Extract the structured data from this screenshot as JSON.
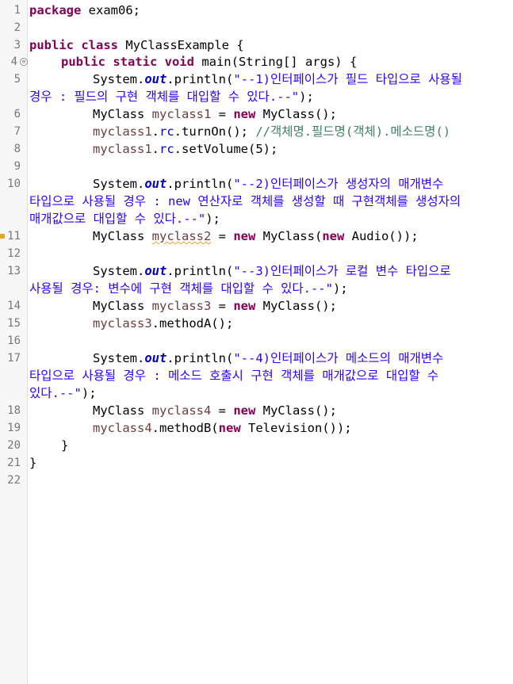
{
  "editor": {
    "line_numbers": [
      "1",
      "2",
      "3",
      "4",
      "5",
      "6",
      "7",
      "8",
      "9",
      "10",
      "11",
      "12",
      "13",
      "14",
      "15",
      "16",
      "17",
      "18",
      "19",
      "20",
      "21",
      "22"
    ],
    "icons": {
      "fold_marker": "collapse-icon",
      "warning_marker": "warning-icon"
    },
    "colors": {
      "keyword": "#7f0055",
      "string": "#2a00ff",
      "comment": "#3f7f5f",
      "local_variable": "#6a3e3e",
      "field": "#0000c0"
    },
    "tokens": {
      "package_kw": "package",
      "package_name": " exam06;",
      "public_kw": "public",
      "class_kw": " class",
      "class_decl": " MyClassExample {",
      "method_mods": "public static void",
      "main_sig": " main(String[] args) {",
      "sysout_prefix": "System.",
      "out": "out",
      "println_open": ".println(",
      "str1a": "\"--1)인터페이스가 필드 타입으로 사용될",
      "str1b": "경우 : 필드의 구현 객체를 대입할 수 있다.--\"",
      "close_paren_semi": ");",
      "myclass_type": "MyClass ",
      "myclass1": "myclass1",
      "assign_eq": " = ",
      "new_kw": "new",
      "myclass_ctor": " MyClass();",
      "dot": ".",
      "rc": "rc",
      "turnon": ".turnOn(); ",
      "comment7": "//객체명.필드명(객체).메소드명()",
      "setvolume": ".setVolume(5);",
      "str2a": "\"--2)인터페이스가 생성자의 매개변수",
      "str2b": "타입으로 사용될 경우 : new 연산자로 객체를 생성할 때 구현객체를 생성자의",
      "str2c": "매개값으로 대입할 수 있다.--\"",
      "myclass2": "myclass2",
      "myclass_open": " MyClass(",
      "audio_call": " Audio());",
      "str3a": "\"--3)인터페이스가 로컬 변수 타입으로",
      "str3b": "사용될 경우: 변수에 구현 객체를 대입할 수 있다.--\"",
      "myclass3": "myclass3",
      "methoda": ".methodA();",
      "str4a": "\"--4)인터페이스가 메소드의 매개변수",
      "str4b": "타입으로 사용될 경우 : 메소드 호출시 구현 객체를 매개값으로 대입할 수",
      "str4c": "있다.--\"",
      "myclass4": "myclass4",
      "methodb_open": ".methodB(",
      "television_call": " Television());",
      "close_brace": "}"
    }
  }
}
